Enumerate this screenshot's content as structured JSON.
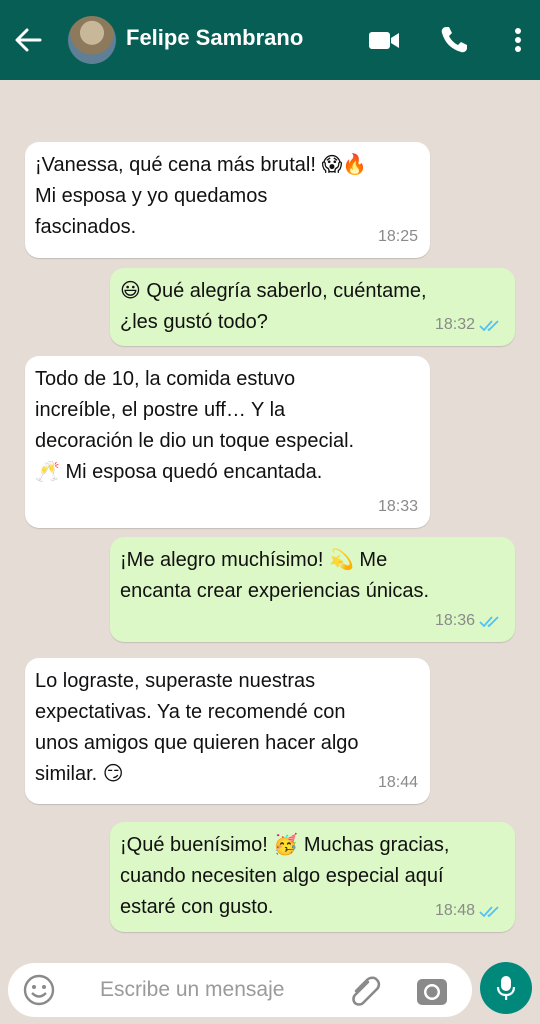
{
  "header": {
    "contact_name": "Felipe Sambrano"
  },
  "messages": [
    {
      "direction": "incoming",
      "text": "¡Vanessa, qué cena más brutal! 😱🔥\nMi esposa y yo quedamos\nfascinados.",
      "time": "18:25"
    },
    {
      "direction": "outgoing",
      "text": "😃 Qué alegría saberlo, cuéntame,\n¿les gustó todo?",
      "time": "18:32"
    },
    {
      "direction": "incoming",
      "text": "Todo de 10, la comida estuvo\nincreíble, el postre uff… Y la\ndecoración le dio un toque especial.\n🥂 Mi esposa quedó encantada.",
      "time": "18:33"
    },
    {
      "direction": "outgoing",
      "text": "¡Me alegro muchísimo! 💫 Me\nencanta crear experiencias únicas.",
      "time": "18:36"
    },
    {
      "direction": "incoming",
      "text": "Lo lograste, superaste nuestras\nexpectativas. Ya te recomendé con\nunos amigos que quieren hacer algo\nsimilar. 😏",
      "time": "18:44"
    },
    {
      "direction": "outgoing",
      "text": "¡Qué buenísimo! 🥳 Muchas gracias,\ncuando necesiten algo especial aquí\nestaré con gusto.",
      "time": "18:48"
    }
  ],
  "input": {
    "placeholder": "Escribe un mensaje"
  },
  "colors": {
    "header": "#075e54",
    "chat_background": "#e5ddd5",
    "outgoing_bubble": "#dcf8c6",
    "incoming_bubble": "#ffffff",
    "read_tick": "#4fc3f7",
    "mic_button": "#00897b"
  },
  "icons": [
    "back-arrow-icon",
    "video-call-icon",
    "phone-icon",
    "more-options-icon",
    "emoji-icon",
    "attach-clip-icon",
    "camera-icon",
    "mic-icon",
    "double-check-icon"
  ]
}
